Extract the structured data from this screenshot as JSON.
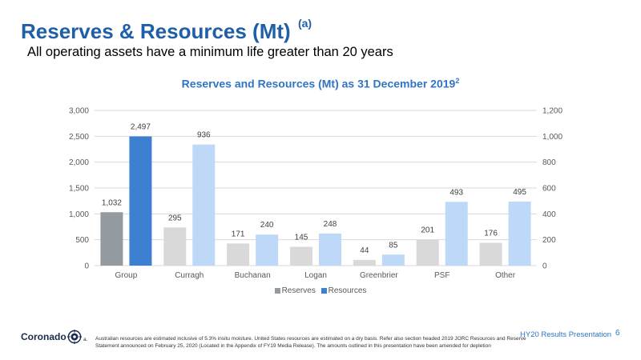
{
  "header": {
    "title": "Reserves & Resources (Mt)",
    "title_note": "(a)",
    "subtitle": "All operating assets have a minimum life greater than 20 years"
  },
  "chart_data": {
    "type": "bar",
    "title": "Reserves and Resources (Mt) as 31 December 2019",
    "title_note": "2",
    "categories": [
      "Group",
      "Curragh",
      "Buchanan",
      "Logan",
      "Greenbrier",
      "PSF",
      "Other"
    ],
    "series": [
      {
        "name": "Reserves",
        "values": [
          1032,
          295,
          171,
          145,
          44,
          201,
          176
        ],
        "labels": [
          "1,032",
          "295",
          "171",
          "145",
          "44",
          "201",
          "176"
        ]
      },
      {
        "name": "Resources",
        "values": [
          2497,
          936,
          240,
          248,
          85,
          493,
          495
        ],
        "labels": [
          "2,497",
          "936",
          "240",
          "248",
          "85",
          "493",
          "495"
        ]
      }
    ],
    "yleft": {
      "min": 0,
      "max": 3000,
      "ticks": [
        "0",
        "500",
        "1,000",
        "1,500",
        "2,000",
        "2,500",
        "3,000"
      ],
      "tick_values": [
        0,
        500,
        1000,
        1500,
        2000,
        2500,
        3000
      ]
    },
    "yright": {
      "min": 0,
      "max": 1200,
      "ticks": [
        "0",
        "200",
        "400",
        "600",
        "800",
        "1,000",
        "1,200"
      ],
      "tick_values": [
        0,
        200,
        400,
        600,
        800,
        1000,
        1200
      ]
    },
    "note": "Group values on left axis; all other categories on right axis",
    "grid": true,
    "legend_position": "bottom",
    "colors": {
      "group_reserves": "#939aa0",
      "group_resources": "#3d7fd1",
      "reserves": "#d9d9d9",
      "resources": "#bdd9f7",
      "grid": "#d9d9d9"
    }
  },
  "footer": {
    "logo_text": "Coronado",
    "footnote_marker": "a.",
    "footnote": "Australian resources are estimated inclusive of 5.3% insitu moisture. United States resources are estimated on a dry basis. Refer also section headed 2019 JORC Resources and Reserve Statement announced on February 25, 2020 (Located in the Appendix of FY19 Media Release). The amounts outlined in this presentation have been amended for depletion",
    "presentation_title": "HY20 Results Presentation",
    "page_number": "6"
  }
}
